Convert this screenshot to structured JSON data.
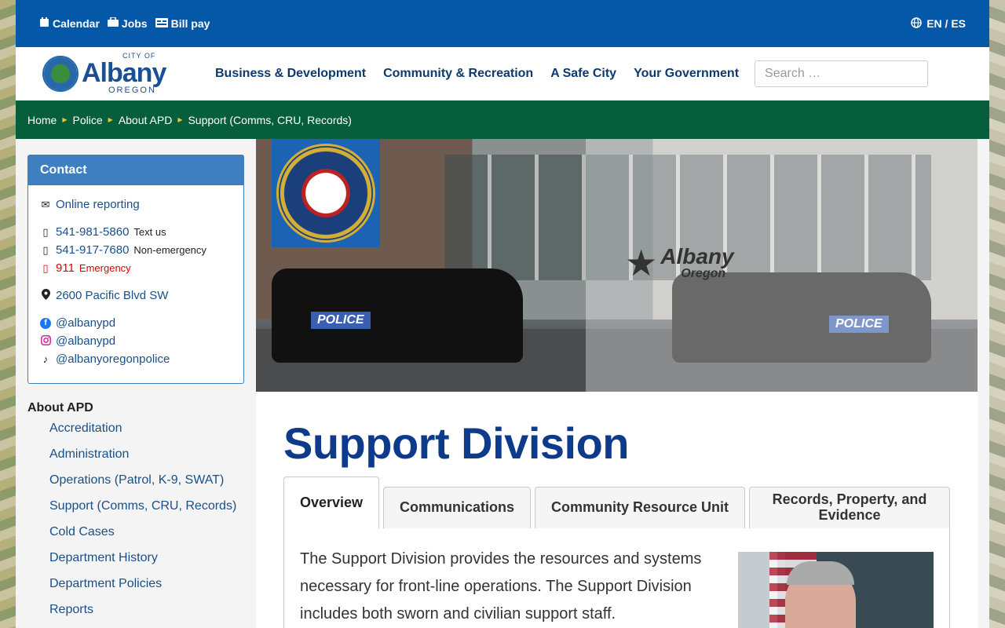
{
  "topbar": {
    "links": [
      {
        "icon": "calendar-icon",
        "label": "Calendar"
      },
      {
        "icon": "briefcase-icon",
        "label": "Jobs"
      },
      {
        "icon": "bill-icon",
        "label": "Bill pay"
      }
    ],
    "language": "EN / ES"
  },
  "header": {
    "logo": {
      "city": "CITY OF",
      "name": "Albany",
      "state": "OREGON"
    },
    "nav": [
      "Business & Development",
      "Community & Recreation",
      "A Safe City",
      "Your Government"
    ],
    "search_placeholder": "Search …"
  },
  "breadcrumb": [
    "Home",
    "Police",
    "About APD",
    "Support (Comms, CRU, Records)"
  ],
  "contact": {
    "title": "Contact",
    "online_reporting": "Online reporting",
    "phones": [
      {
        "number": "541-981-5860",
        "note": "Text us"
      },
      {
        "number": "541-917-7680",
        "note": "Non-emergency"
      },
      {
        "number": "911",
        "note": "Emergency"
      }
    ],
    "address": "2600 Pacific Blvd SW",
    "social": [
      {
        "icon": "facebook-icon",
        "handle": "@albanypd"
      },
      {
        "icon": "instagram-icon",
        "handle": "@albanypd"
      },
      {
        "icon": "tiktok-icon",
        "handle": "@albanyoregonpolice"
      }
    ]
  },
  "side_menu": {
    "title": "About APD",
    "items": [
      "Accreditation",
      "Administration",
      "Operations (Patrol, K-9, SWAT)",
      "Support (Comms, CRU, Records)",
      "Cold Cases",
      "Department History",
      "Department Policies",
      "Reports"
    ]
  },
  "hero": {
    "car_label": "POLICE",
    "brand_line1": "Albany",
    "brand_line2": "Oregon"
  },
  "article": {
    "title": "Support Division",
    "tabs": [
      "Overview",
      "Communications",
      "Community Resource Unit",
      "Records, Property, and Evidence"
    ],
    "active_tab": 0,
    "overview_text": "The Support Division provides the resources and systems necessary for front-line operations. The Support Division includes both sworn and civilian support staff."
  },
  "colors": {
    "topbar": "#0557a8",
    "breadcrumb": "#075e3c",
    "accent": "#3d7fc0",
    "title": "#0d3a8a",
    "emergency": "#dd0000"
  }
}
